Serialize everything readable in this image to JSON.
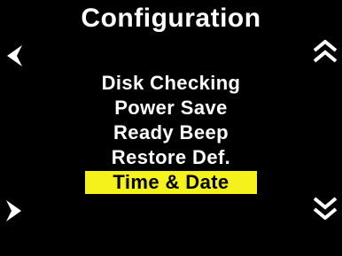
{
  "screen": {
    "title": "Configuration",
    "menu": {
      "items": [
        {
          "label": "Disk Checking",
          "selected": false
        },
        {
          "label": "Power Save",
          "selected": false
        },
        {
          "label": "Ready Beep",
          "selected": false
        },
        {
          "label": "Restore Def.",
          "selected": false
        },
        {
          "label": "Time & Date",
          "selected": true
        }
      ]
    },
    "nav_icons": {
      "back": "chevron-left-icon",
      "forward": "chevron-right-icon",
      "scroll_up": "double-chevron-up-icon",
      "scroll_down": "double-chevron-down-icon"
    },
    "colors": {
      "background": "#000000",
      "text": "#ffffff",
      "highlight": "#f4f21a",
      "highlight_text": "#000000"
    }
  }
}
